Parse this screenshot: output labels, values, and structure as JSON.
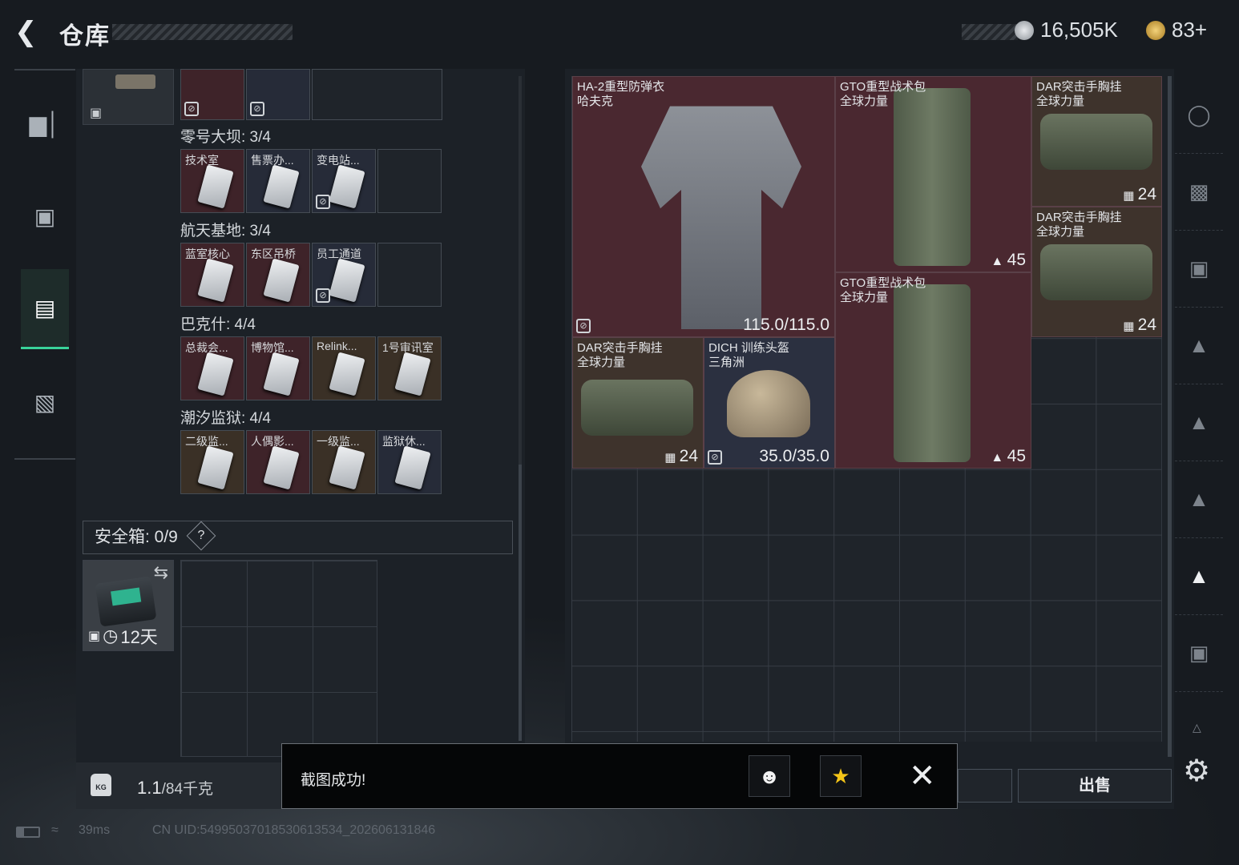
{
  "header": {
    "title": "仓库",
    "currency": {
      "silver": "16,505K",
      "gold": "83+"
    }
  },
  "left_nav": {
    "items": [
      "gun-icon",
      "armor-icon",
      "backpack-icon",
      "toolbox-icon"
    ],
    "active_index": 2
  },
  "keycards": {
    "sections": [
      {
        "name": "零号大坝: 3/4",
        "cards": [
          {
            "label": "技术室",
            "tone": "red",
            "locked": false
          },
          {
            "label": "售票办...",
            "tone": "blue",
            "locked": false
          },
          {
            "label": "变电站...",
            "tone": "blue",
            "locked": true
          },
          {
            "label": "",
            "tone": "empty",
            "locked": false
          }
        ]
      },
      {
        "name": "航天基地: 3/4",
        "cards": [
          {
            "label": "蓝室核心",
            "tone": "red",
            "locked": false
          },
          {
            "label": "东区吊桥",
            "tone": "red",
            "locked": false
          },
          {
            "label": "员工通道",
            "tone": "blue",
            "locked": true
          },
          {
            "label": "",
            "tone": "empty",
            "locked": false
          }
        ]
      },
      {
        "name": "巴克什: 4/4",
        "cards": [
          {
            "label": "总裁会...",
            "tone": "red",
            "locked": false
          },
          {
            "label": "博物馆...",
            "tone": "red",
            "locked": false
          },
          {
            "label": "Relink...",
            "tone": "gold",
            "locked": false
          },
          {
            "label": "1号审讯室",
            "tone": "gold",
            "locked": false
          }
        ]
      },
      {
        "name": "潮汐监狱: 4/4",
        "cards": [
          {
            "label": "二级监...",
            "tone": "gold",
            "locked": false
          },
          {
            "label": "人偶影...",
            "tone": "red",
            "locked": false
          },
          {
            "label": "一级监...",
            "tone": "gold",
            "locked": false
          },
          {
            "label": "监狱休...",
            "tone": "blue",
            "locked": false
          }
        ]
      }
    ]
  },
  "safe_box": {
    "label": "安全箱: 0/9",
    "help": "?",
    "duration": "12天"
  },
  "weight": {
    "value": "1.1",
    "max": "/84千克"
  },
  "stash": {
    "items": [
      {
        "name": "HA-2重型防弹衣\n哈夫克",
        "value": "115.0/115.0"
      },
      {
        "name": "GTO重型战术包\n全球力量",
        "value": "45"
      },
      {
        "name": "DAR突击手胸挂\n全球力量",
        "value": "24"
      },
      {
        "name": "DAR突击手胸挂\n全球力量",
        "value": "24"
      },
      {
        "name": "GTO重型战术包\n全球力量",
        "value": "45"
      },
      {
        "name": "DAR突击手胸挂\n全球力量",
        "value": "24"
      },
      {
        "name": "DICH 训练头盔\n三角洲",
        "value": "35.0/35.0"
      }
    ]
  },
  "sell_label": "出售",
  "toast": {
    "message": "截图成功!"
  },
  "status": {
    "ping": "39ms",
    "uid": "CN UID:54995037018530613534_202606131846"
  }
}
